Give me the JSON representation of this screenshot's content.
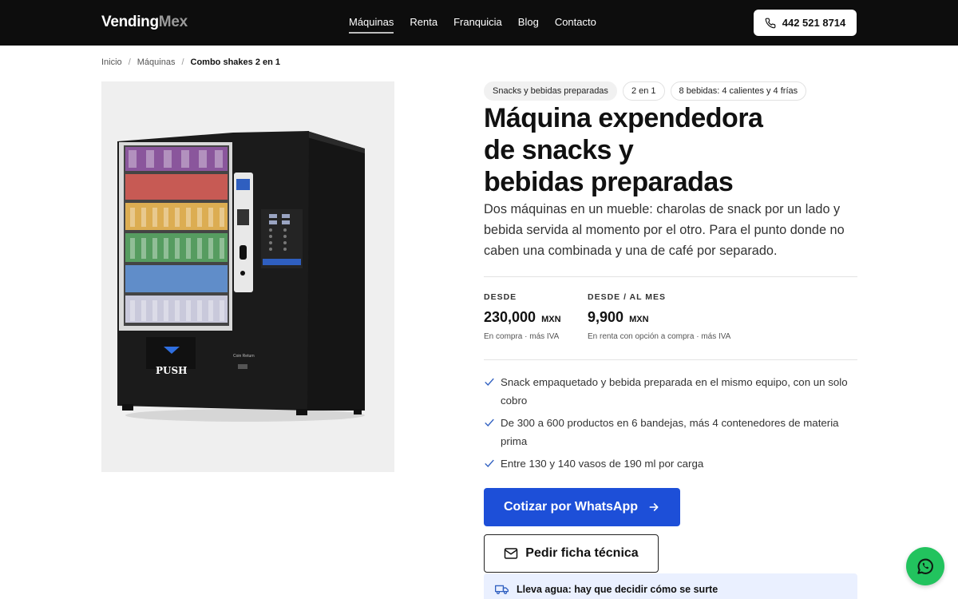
{
  "brand": {
    "part1": "Vending",
    "part2": "Mex"
  },
  "nav": {
    "items": [
      {
        "label": "Máquinas",
        "active": true
      },
      {
        "label": "Renta",
        "active": false
      },
      {
        "label": "Franquicia",
        "active": false
      },
      {
        "label": "Blog",
        "active": false
      },
      {
        "label": "Contacto",
        "active": false
      }
    ],
    "phone": "442 521 8714"
  },
  "breadcrumb": {
    "items": [
      "Inicio",
      "Máquinas"
    ],
    "current": "Combo shakes 2 en 1"
  },
  "product": {
    "image_text": {
      "push": "PUSH",
      "coin_return": "Coin Return"
    },
    "tags": [
      "Snacks y bebidas preparadas",
      "2 en 1",
      "8 bebidas: 4 calientes y 4 frías"
    ],
    "title_lines": [
      "Máquina expendedora",
      "de snacks y",
      "bebidas preparadas"
    ],
    "description": "Dos máquinas en un mueble: charolas de snack por un lado y bebida servida al momento por el otro. Para el punto donde no caben una combinada y una de café por separado.",
    "prices": [
      {
        "label": "DESDE",
        "value": "230,000",
        "currency": "MXN",
        "note": "En compra · más IVA"
      },
      {
        "label": "DESDE / AL MES",
        "value": "9,900",
        "currency": "MXN",
        "note": "En renta con opción a compra · más IVA"
      }
    ],
    "features": [
      "Snack empaquetado y bebida preparada en el mismo equipo, con un solo cobro",
      "De 300 a 600 productos en 6 bandejas, más 4 contenedores de materia prima",
      "Entre 130 y 140 vasos de 190 ml por carga"
    ],
    "cta_whatsapp": "Cotizar por WhatsApp",
    "cta_sheet": "Pedir ficha técnica",
    "notice": "Lleva agua: hay que decidir cómo se surte"
  },
  "colors": {
    "topbar": "#0d0d0d",
    "primary": "#1d4fd8",
    "whatsapp": "#22c35e",
    "notice_bg": "#eaf0ff"
  }
}
